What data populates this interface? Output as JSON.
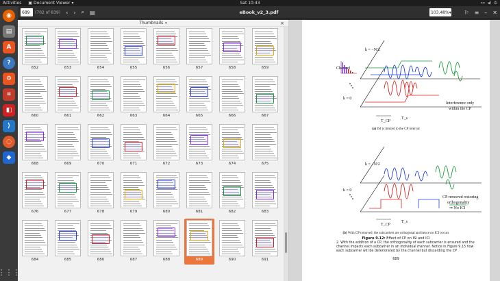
{
  "topbar": {
    "activities": "Activities",
    "app_name": "Document Viewer",
    "clock": "Sat 10:43"
  },
  "header": {
    "page_input": "689",
    "page_count": "(702 of 839)",
    "title": "eBook_v2_3.pdf",
    "zoom": "103.48%"
  },
  "sidebar": {
    "title": "Thumbnails",
    "rows": [
      [
        "652",
        "653",
        "654",
        "655",
        "656",
        "657",
        "658",
        "659"
      ],
      [
        "660",
        "661",
        "662",
        "663",
        "664",
        "665",
        "666",
        "667"
      ],
      [
        "668",
        "669",
        "670",
        "671",
        "672",
        "673",
        "674",
        "675"
      ],
      [
        "676",
        "677",
        "678",
        "679",
        "680",
        "681",
        "682",
        "683"
      ],
      [
        "684",
        "685",
        "686",
        "687",
        "688",
        "689",
        "690",
        "691"
      ]
    ],
    "selected": "689"
  },
  "document": {
    "fig_a": {
      "label_top": "k = −N/2",
      "label_channel": "Channel",
      "label_k0": "k = 0",
      "label_interf": "Interference only",
      "label_interf2": "within the CP",
      "label_tcp": "T_CP",
      "label_ts": "T_s",
      "caption_letter": "(a)",
      "caption": "ISI is limited to the CP interval"
    },
    "fig_b": {
      "label_top": "k = −N/2",
      "label_k0": "k = 0",
      "label_cp1": "CP removed restoring",
      "label_cp2": "orthogonality",
      "label_cp3": "⇒ No ICI",
      "label_tcp": "T_CP",
      "label_ts": "T_s",
      "caption_letter": "(b)",
      "caption": "With CP removed, the subcarriers are orthogonal and hence no ICI occurs"
    },
    "figure_label": "Figure 9.12:",
    "figure_caption": "Effect of CP on ISI and ICI",
    "paragraph_lead": "2.",
    "paragraph": "With the addition of a CP, the orthogonality of each subcarrier is ensured and the channel impacts each subcarrier in an individual manner. Notice in Figure 9.13 how each subcarrier will be deteriorated by the channel but discarding the CP",
    "page_number": "689"
  },
  "colors": {
    "accent": "#e9773e",
    "red": "#d6201f",
    "blue": "#1f3fd6",
    "green": "#1a9a3a"
  }
}
